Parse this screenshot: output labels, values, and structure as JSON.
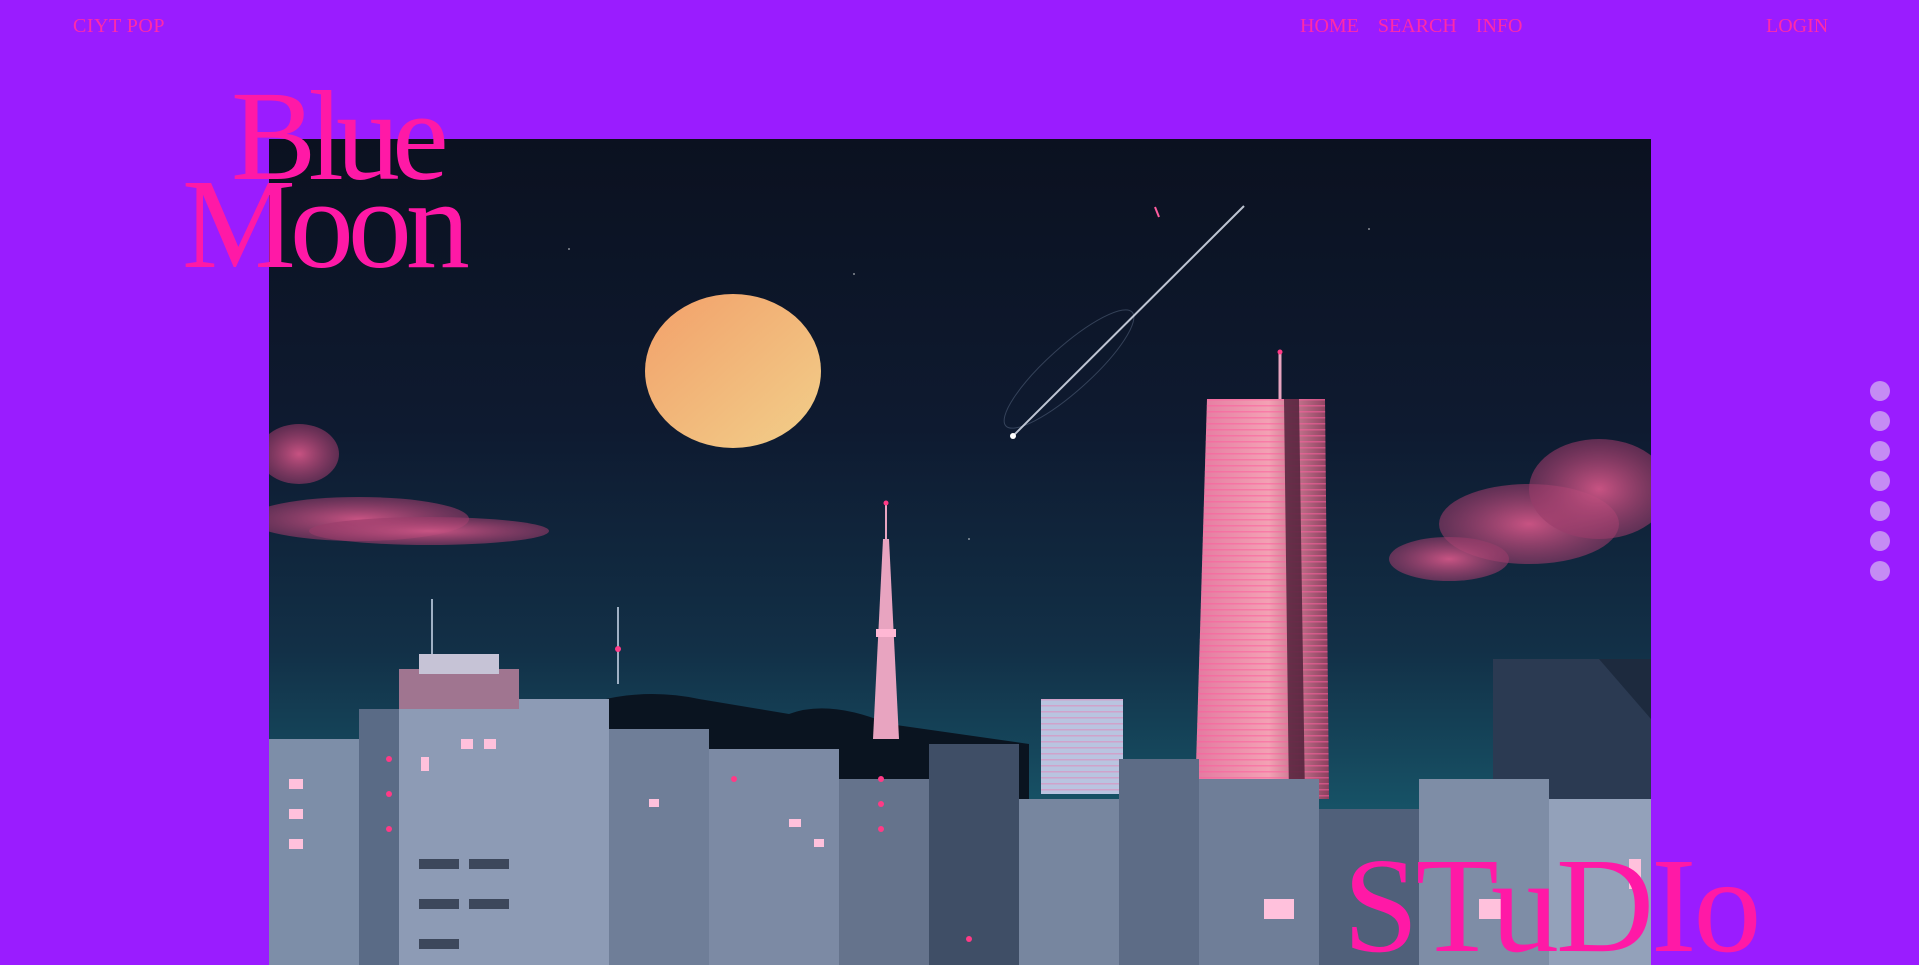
{
  "header": {
    "brand": "CIYT POP",
    "nav": [
      "HOME",
      "SEARCH",
      "INFO"
    ],
    "login": "LOGIN"
  },
  "hero": {
    "title_line1": "Blue",
    "title_line2": "Moon",
    "footer_word": "STuDIo",
    "image_description_icon": "night-city-skyline-image"
  },
  "pager": {
    "count": 7
  },
  "colors": {
    "background": "#9a1cff",
    "accent": "#ff19a6",
    "dot": "#c58cf4"
  }
}
